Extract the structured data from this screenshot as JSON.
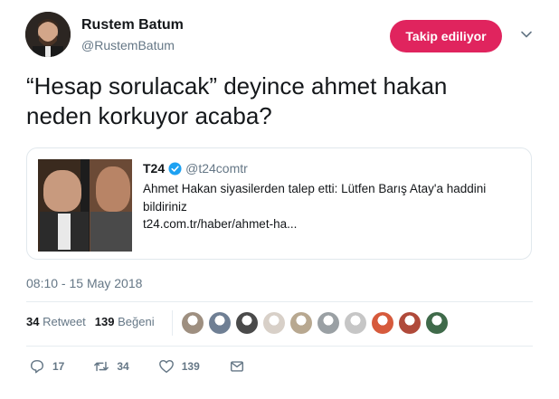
{
  "author": {
    "name": "Rustem Batum",
    "handle": "@RustemBatum"
  },
  "follow_button": {
    "label": "Takip ediliyor",
    "color": "#e0245e"
  },
  "tweet": {
    "text_line1": "“Hesap sorulacak” deyince ahmet hakan",
    "text_line2": "neden korkuyor acaba?"
  },
  "card": {
    "site_name": "T24",
    "site_handle": "@t24comtr",
    "description_line1": "Ahmet Hakan siyasilerden talep etti: Lütfen Barış Atay'a haddini",
    "description_line2": "bildiriniz",
    "url": "t24.com.tr/haber/ahmet-ha..."
  },
  "timestamp": "08:10 - 15 May 2018",
  "stats": {
    "retweets_count": "34",
    "retweets_label": "Retweet",
    "likes_count": "139",
    "likes_label": "Beğeni",
    "liker_avatar_colors": [
      "#9e8f80",
      "#6f7f94",
      "#4a4a4a",
      "#d8d0c8",
      "#b8a890",
      "#9aa0a4",
      "#c6c6c6",
      "#d65a3c",
      "#b04a3a",
      "#3f6a4a"
    ]
  },
  "actions": {
    "replies": "17",
    "retweets": "34",
    "likes": "139"
  },
  "colors": {
    "secondary_text": "#657786",
    "primary_text": "#14171a",
    "verified_blue": "#1da1f2"
  }
}
